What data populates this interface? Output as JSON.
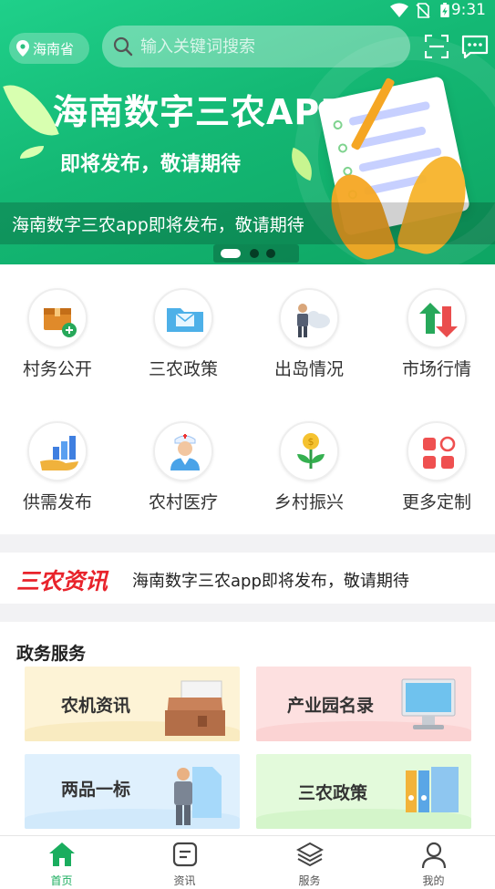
{
  "status_bar": {
    "time": "9:31"
  },
  "header": {
    "location": "海南省",
    "search_placeholder": "输入关键词搜索"
  },
  "banner": {
    "title": "海南数字三农APP",
    "subtitle": "即将发布，敬请期待",
    "caption": "海南数字三农app即将发布，敬请期待",
    "page_count": 3,
    "active_page": 1
  },
  "functions": [
    {
      "label": "村务公开",
      "icon": "box-plus-icon"
    },
    {
      "label": "三农政策",
      "icon": "folder-mail-icon"
    },
    {
      "label": "出岛情况",
      "icon": "person-cloud-icon"
    },
    {
      "label": "市场行情",
      "icon": "up-down-arrows-icon"
    },
    {
      "label": "供需发布",
      "icon": "hand-chart-icon"
    },
    {
      "label": "农村医疗",
      "icon": "doctor-icon"
    },
    {
      "label": "乡村振兴",
      "icon": "coin-sprout-icon"
    },
    {
      "label": "更多定制",
      "icon": "grid-apps-icon"
    }
  ],
  "news_ticker": {
    "brand": "三农资讯",
    "text": "海南数字三农app即将发布，敬请期待"
  },
  "gov_services": {
    "title": "政务服务",
    "cards": [
      {
        "label": "农机资讯",
        "color": "#fdf3d6",
        "icon": "briefcase-icon"
      },
      {
        "label": "产业园名录",
        "color": "#fde0e0",
        "icon": "monitor-icon"
      },
      {
        "label": "两品一标",
        "color": "#dff0fd",
        "icon": "person-document-icon"
      },
      {
        "label": "三农政策",
        "color": "#e3fadb",
        "icon": "binders-icon"
      }
    ]
  },
  "bottom_nav": [
    {
      "label": "首页",
      "icon": "home-icon",
      "active": true
    },
    {
      "label": "资讯",
      "icon": "news-icon",
      "active": false
    },
    {
      "label": "服务",
      "icon": "layers-icon",
      "active": false
    },
    {
      "label": "我的",
      "icon": "user-icon",
      "active": false
    }
  ],
  "colors": {
    "accent": "#1aad5e",
    "banner_green": "#14b874",
    "brand_red": "#e8232b"
  }
}
